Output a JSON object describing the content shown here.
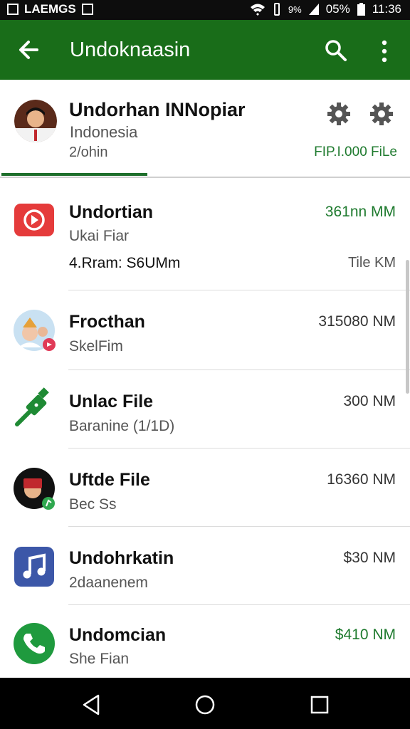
{
  "status_bar": {
    "left_label": "LAEMGS",
    "signal": "9%",
    "battery": "05%",
    "time": "11:36"
  },
  "app_bar": {
    "title": "Undoknaasin"
  },
  "profile": {
    "name": "Undorhan INNopiar",
    "country": "Indonesia",
    "count": "2/ohin",
    "files": "FIP.I.000 FiLe"
  },
  "items": [
    {
      "name": "Undortian",
      "sub": "Ukai Fiar",
      "size": "361nn MM",
      "extra": "4.Rram: S6UMm",
      "extra2": "Tile KM"
    },
    {
      "name": "Frocthan",
      "sub": "SkelFim",
      "size": "315080 NM"
    },
    {
      "name": "Unlac File",
      "sub": "Baranine (1/1D)",
      "size": "300 NM"
    },
    {
      "name": "Uftde File",
      "sub": "Bec Ss",
      "size": "16360 NM"
    },
    {
      "name": "Undohrkatin",
      "sub": "2daanenem",
      "size": "$30 NM"
    },
    {
      "name": "Undomcian",
      "sub": "She Fian",
      "size": "$410 NM"
    }
  ],
  "colors": {
    "app_bar": "#196d19",
    "accent_green": "#1e7a2e"
  }
}
